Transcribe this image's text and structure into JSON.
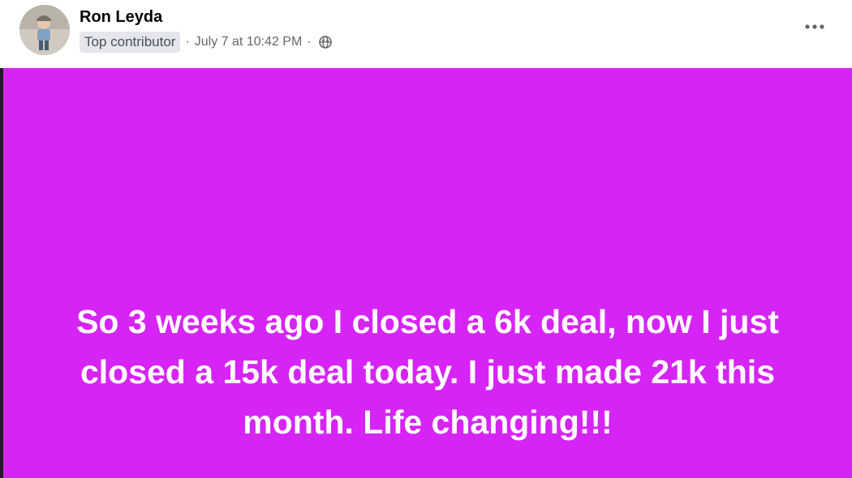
{
  "post": {
    "author_name": "Ron Leyda",
    "badge_label": "Top contributor",
    "separator": "·",
    "timestamp": "July 7 at 10:42 PM",
    "privacy_icon": "globe-icon",
    "more_icon": "more-horizontal-icon",
    "body_text": "So 3 weeks ago I closed a 6k deal, now I just closed a 15k deal today. I just made 21k this month. Life changing!!!",
    "background_color": "#d624f7",
    "text_color": "#ffffff"
  }
}
